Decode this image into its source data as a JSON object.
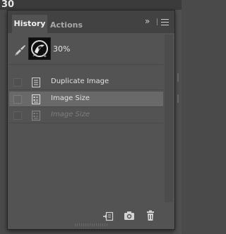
{
  "app": {
    "doc_tab_fragment": "30"
  },
  "panel": {
    "tabs": [
      {
        "label": "History",
        "active": true
      },
      {
        "label": "Actions",
        "active": false
      }
    ],
    "expand_glyph": "»",
    "menu_icon": "hamburger-icon"
  },
  "history": {
    "snapshot": {
      "label": "30%",
      "icon": "history-brush-icon"
    },
    "states": [
      {
        "label": "Duplicate Image",
        "icon": "document-icon",
        "selected": false,
        "dimmed": false
      },
      {
        "label": "Image Size",
        "icon": "resize-image-icon",
        "selected": true,
        "dimmed": false
      },
      {
        "label": "Image Size",
        "icon": "resize-image-icon",
        "selected": false,
        "dimmed": true
      }
    ]
  },
  "bottom_toolbar": {
    "buttons": [
      {
        "name": "new-document-from-state",
        "icon": "new-document-icon"
      },
      {
        "name": "create-snapshot",
        "icon": "camera-icon"
      },
      {
        "name": "delete-state",
        "icon": "trash-icon"
      }
    ]
  },
  "colors": {
    "panel_bg": "#535353",
    "tab_bar_bg": "#424242",
    "selected_row": "#696969"
  }
}
